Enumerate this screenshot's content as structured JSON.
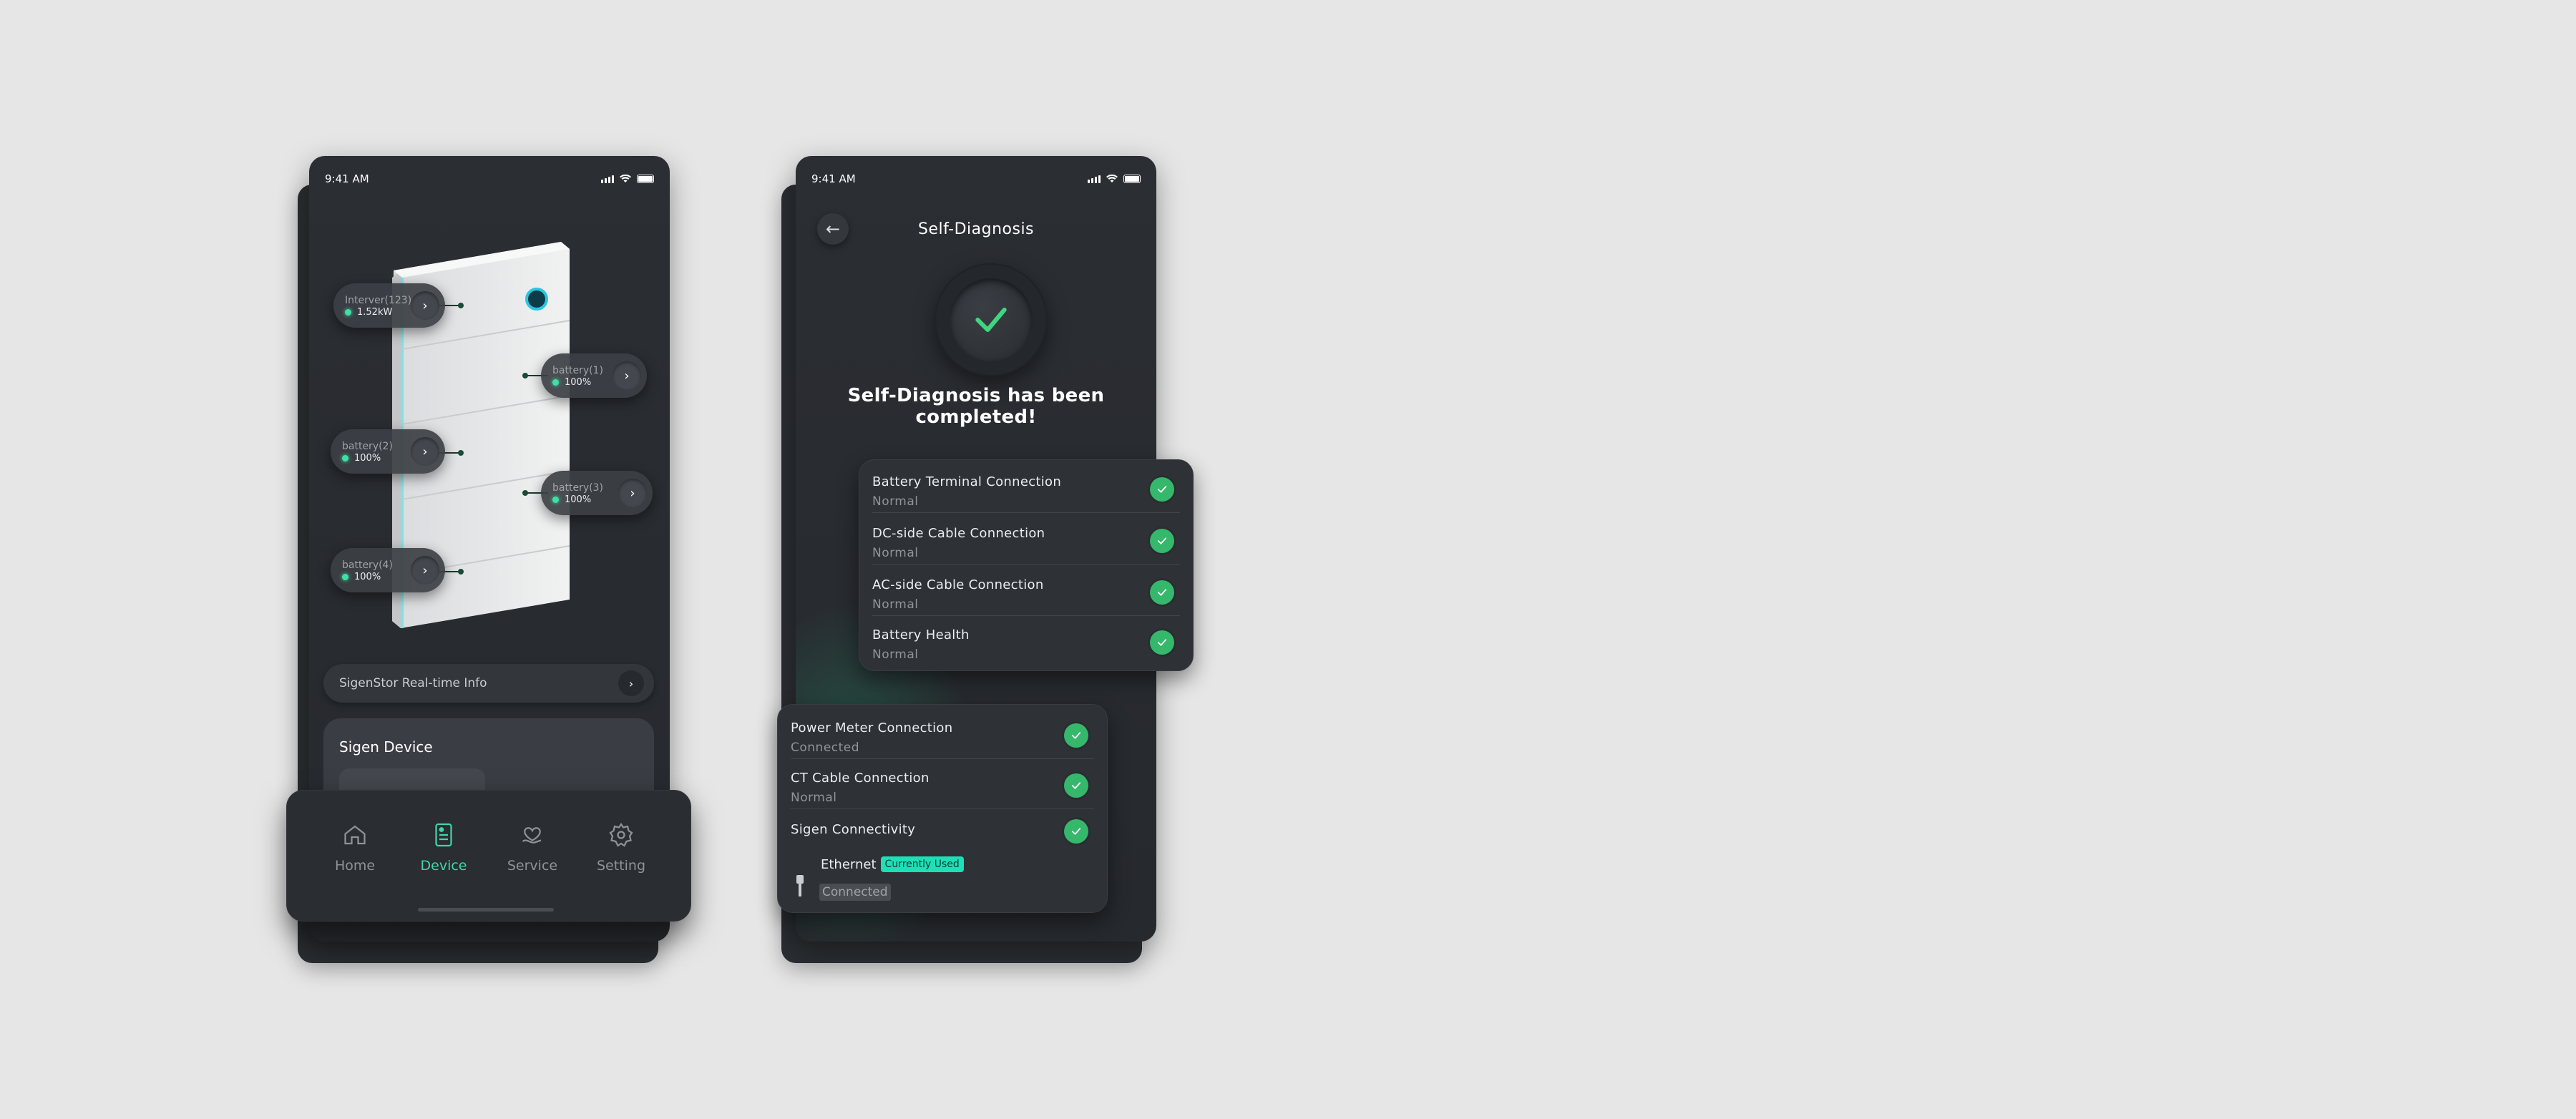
{
  "device_phone": {
    "status_time": "9:41 AM",
    "callouts": [
      {
        "label": "Interver(123)",
        "value": "1.52kW"
      },
      {
        "label": "battery(1)",
        "value": "100%"
      },
      {
        "label": "battery(2)",
        "value": "100%"
      },
      {
        "label": "battery(3)",
        "value": "100%"
      },
      {
        "label": "battery(4)",
        "value": "100%"
      }
    ],
    "info_bar": "SigenStor Real-time Info",
    "card_title": "Sigen Device",
    "tabs": [
      {
        "label": "Home",
        "icon": "home-icon"
      },
      {
        "label": "Device",
        "icon": "device-icon",
        "active": true
      },
      {
        "label": "Service",
        "icon": "service-icon"
      },
      {
        "label": "Setting",
        "icon": "gear-icon"
      }
    ]
  },
  "diag_phone": {
    "status_time": "9:41 AM",
    "title": "Self-Diagnosis",
    "completed_text": "Self-Diagnosis has been completed!",
    "card1": [
      {
        "name": "Battery Terminal Connection",
        "status": "Normal"
      },
      {
        "name": "DC-side Cable Connection",
        "status": "Normal"
      },
      {
        "name": "AC-side Cable Connection",
        "status": "Normal"
      },
      {
        "name": "Battery Health",
        "status": "Normal"
      }
    ],
    "card2": [
      {
        "name": "Power Meter Connection",
        "status": "Connected"
      },
      {
        "name": "CT Cable Connection",
        "status": "Normal"
      },
      {
        "name": "Sigen Connectivity",
        "status": ""
      }
    ],
    "ethernet": {
      "label": "Ethernet",
      "badge": "Currently Used",
      "status": "Connected"
    }
  },
  "colors": {
    "accent": "#3fd6a7",
    "ok_green": "#35b86b",
    "bg": "#e6e6e6",
    "panel": "#2b2e33"
  }
}
